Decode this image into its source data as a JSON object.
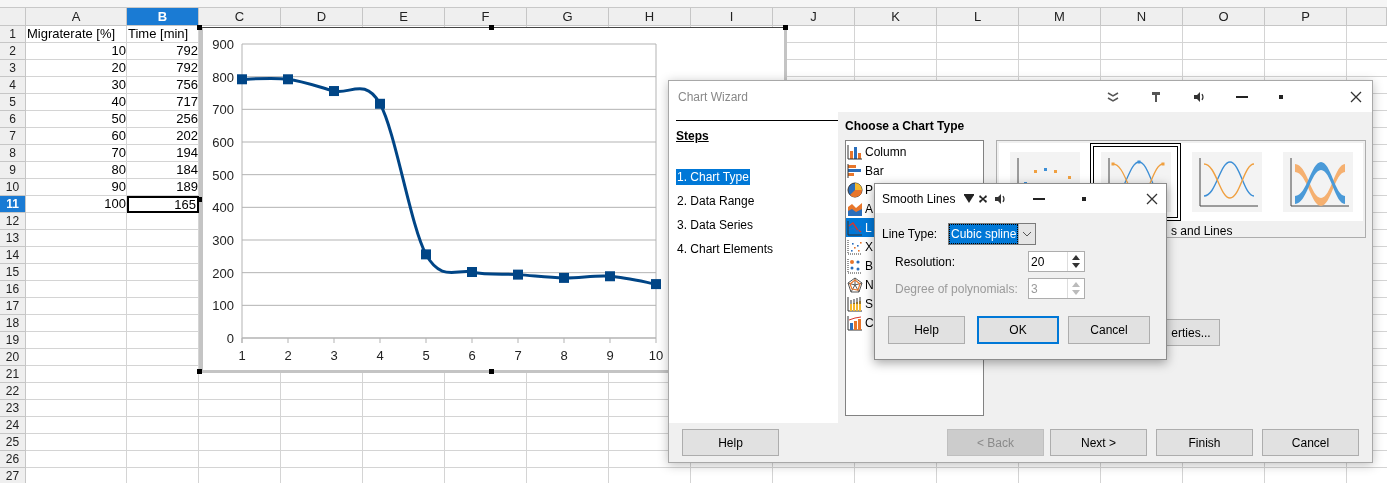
{
  "spreadsheet": {
    "columns": [
      {
        "label": "A",
        "selected": false
      },
      {
        "label": "B",
        "selected": true
      },
      {
        "label": "C",
        "selected": false
      },
      {
        "label": "D",
        "selected": false
      },
      {
        "label": "E",
        "selected": false
      },
      {
        "label": "F",
        "selected": false
      },
      {
        "label": "G",
        "selected": false
      },
      {
        "label": "H",
        "selected": false
      },
      {
        "label": "I",
        "selected": false
      },
      {
        "label": "J",
        "selected": false
      },
      {
        "label": "K",
        "selected": false
      },
      {
        "label": "L",
        "selected": false
      },
      {
        "label": "M",
        "selected": false
      },
      {
        "label": "N",
        "selected": false
      },
      {
        "label": "O",
        "selected": false
      },
      {
        "label": "P",
        "selected": false
      }
    ],
    "rows": [
      {
        "header": "1",
        "selected": false,
        "cells": [
          {
            "value": "Migraterate [%]",
            "kind": "text"
          },
          {
            "value": "Time [min]",
            "kind": "text"
          }
        ]
      },
      {
        "header": "2",
        "selected": false,
        "cells": [
          {
            "value": "10",
            "kind": "number"
          },
          {
            "value": "792",
            "kind": "number"
          }
        ]
      },
      {
        "header": "3",
        "selected": false,
        "cells": [
          {
            "value": "20",
            "kind": "number"
          },
          {
            "value": "792",
            "kind": "number"
          }
        ]
      },
      {
        "header": "4",
        "selected": false,
        "cells": [
          {
            "value": "30",
            "kind": "number"
          },
          {
            "value": "756",
            "kind": "number"
          }
        ]
      },
      {
        "header": "5",
        "selected": false,
        "cells": [
          {
            "value": "40",
            "kind": "number"
          },
          {
            "value": "717",
            "kind": "number"
          }
        ]
      },
      {
        "header": "6",
        "selected": false,
        "cells": [
          {
            "value": "50",
            "kind": "number"
          },
          {
            "value": "256",
            "kind": "number"
          }
        ]
      },
      {
        "header": "7",
        "selected": false,
        "cells": [
          {
            "value": "60",
            "kind": "number"
          },
          {
            "value": "202",
            "kind": "number"
          }
        ]
      },
      {
        "header": "8",
        "selected": false,
        "cells": [
          {
            "value": "70",
            "kind": "number"
          },
          {
            "value": "194",
            "kind": "number"
          }
        ]
      },
      {
        "header": "9",
        "selected": false,
        "cells": [
          {
            "value": "80",
            "kind": "number"
          },
          {
            "value": "184",
            "kind": "number"
          }
        ]
      },
      {
        "header": "10",
        "selected": false,
        "cells": [
          {
            "value": "90",
            "kind": "number"
          },
          {
            "value": "189",
            "kind": "number"
          }
        ]
      },
      {
        "header": "11",
        "selected": true,
        "cells": [
          {
            "value": "100",
            "kind": "number"
          },
          {
            "value": "165",
            "kind": "number"
          }
        ]
      },
      {
        "header": "12",
        "selected": false
      },
      {
        "header": "13",
        "selected": false
      },
      {
        "header": "14",
        "selected": false
      },
      {
        "header": "15",
        "selected": false
      },
      {
        "header": "16",
        "selected": false
      },
      {
        "header": "17",
        "selected": false
      },
      {
        "header": "18",
        "selected": false
      },
      {
        "header": "19",
        "selected": false
      },
      {
        "header": "20",
        "selected": false
      },
      {
        "header": "21",
        "selected": false
      },
      {
        "header": "22",
        "selected": false
      },
      {
        "header": "23",
        "selected": false
      },
      {
        "header": "24",
        "selected": false
      },
      {
        "header": "25",
        "selected": false
      },
      {
        "header": "26",
        "selected": false
      },
      {
        "header": "27",
        "selected": false
      }
    ]
  },
  "chart": {
    "chart_data": {
      "type": "line",
      "categories": [
        "1",
        "2",
        "3",
        "4",
        "5",
        "6",
        "7",
        "8",
        "9",
        "10"
      ],
      "series": [
        {
          "color": "#004586",
          "marker": "square",
          "values": [
            792,
            792,
            756,
            717,
            256,
            202,
            194,
            184,
            189,
            165
          ]
        }
      ],
      "grid": true,
      "ylim": [
        0,
        900
      ],
      "yticks": [
        0,
        100,
        200,
        300,
        400,
        500,
        600,
        700,
        800,
        900
      ]
    }
  },
  "chart_wizard": {
    "title": "Chart Wizard",
    "steps_heading": "Steps",
    "steps": [
      {
        "label": "1. Chart Type",
        "selected": true
      },
      {
        "label": "2. Data Range",
        "selected": false
      },
      {
        "label": "3. Data Series",
        "selected": false
      },
      {
        "label": "4. Chart Elements",
        "selected": false
      }
    ],
    "heading": "Choose a Chart Type",
    "chart_types": [
      {
        "label": "Column",
        "kind": "column",
        "selected": false
      },
      {
        "label": "Bar",
        "kind": "bar",
        "selected": false
      },
      {
        "label": "P",
        "kind": "pie",
        "selected": false
      },
      {
        "label": "A",
        "kind": "area",
        "selected": false
      },
      {
        "label": "L",
        "kind": "line",
        "selected": true
      },
      {
        "label": "X",
        "kind": "xy",
        "selected": false
      },
      {
        "label": "B",
        "kind": "bubble",
        "selected": false
      },
      {
        "label": "N",
        "kind": "net",
        "selected": false
      },
      {
        "label": "S",
        "kind": "stock",
        "selected": false
      },
      {
        "label": "C",
        "kind": "combo",
        "selected": false
      }
    ],
    "subtypes": [
      {
        "kind": "points",
        "selected": false
      },
      {
        "kind": "pointlines",
        "selected": true
      },
      {
        "kind": "lines",
        "selected": false
      },
      {
        "kind": "ribbon",
        "selected": false
      }
    ],
    "subtype_label": "s and Lines",
    "properties_button": "erties...",
    "buttons": [
      {
        "label": "Help",
        "disabled": false
      },
      {
        "label": "< Back",
        "disabled": true
      },
      {
        "label": "Next >",
        "disabled": false
      },
      {
        "label": "Finish",
        "disabled": false
      },
      {
        "label": "Cancel",
        "disabled": false
      }
    ]
  },
  "smooth_lines": {
    "title": "Smooth Lines",
    "line_type": {
      "label": "Line Type:",
      "value": "Cubic spline"
    },
    "fields": [
      {
        "label": "Resolution:",
        "value": "20",
        "disabled": false
      },
      {
        "label": "Degree of polynomials:",
        "value": "3",
        "disabled": true
      }
    ],
    "buttons": [
      {
        "label": "Help",
        "default": false
      },
      {
        "label": "OK",
        "default": true
      },
      {
        "label": "Cancel",
        "default": false
      }
    ]
  }
}
